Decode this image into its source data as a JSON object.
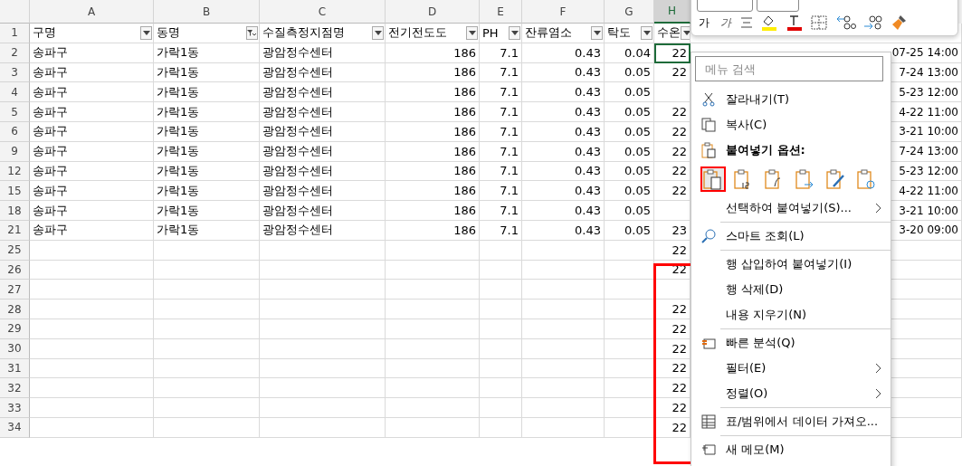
{
  "header_row_num": "1",
  "columns": [
    {
      "letter": "A",
      "header": "구명",
      "filtered": false,
      "selected": false
    },
    {
      "letter": "B",
      "header": "동명",
      "filtered": true,
      "selected": false
    },
    {
      "letter": "C",
      "header": "수질측정지점명",
      "filtered": false,
      "selected": false
    },
    {
      "letter": "D",
      "header": "전기전도도",
      "filtered": false,
      "selected": false
    },
    {
      "letter": "E",
      "header": "PH",
      "filtered": false,
      "selected": false
    },
    {
      "letter": "F",
      "header": "잔류염소",
      "filtered": false,
      "selected": false
    },
    {
      "letter": "G",
      "header": "탁도",
      "filtered": false,
      "selected": false
    },
    {
      "letter": "H",
      "header": "수온",
      "filtered": false,
      "selected": true
    }
  ],
  "rows": [
    {
      "num": "2",
      "cells": [
        "송파구",
        "가락1동",
        "광암정수센터",
        "186",
        "7.1",
        "0.43",
        "0.04",
        "22"
      ],
      "right": "07-25 14:00",
      "selected": true
    },
    {
      "num": "3",
      "cells": [
        "송파구",
        "가락1동",
        "광암정수센터",
        "186",
        "7.1",
        "0.43",
        "0.05",
        "22"
      ],
      "right": "7-24 13:00",
      "selected": false
    },
    {
      "num": "4",
      "cells": [
        "송파구",
        "가락1동",
        "광암정수센터",
        "186",
        "7.1",
        "0.43",
        "0.05",
        ""
      ],
      "right": "5-23 12:00",
      "selected": false
    },
    {
      "num": "5",
      "cells": [
        "송파구",
        "가락1동",
        "광암정수센터",
        "186",
        "7.1",
        "0.43",
        "0.05",
        "22"
      ],
      "right": "4-22 11:00",
      "selected": false
    },
    {
      "num": "6",
      "cells": [
        "송파구",
        "가락1동",
        "광암정수센터",
        "186",
        "7.1",
        "0.43",
        "0.05",
        "22"
      ],
      "right": "3-21 10:00",
      "selected": false
    },
    {
      "num": "9",
      "cells": [
        "송파구",
        "가락1동",
        "광암정수센터",
        "186",
        "7.1",
        "0.43",
        "0.05",
        "22"
      ],
      "right": "7-24 13:00",
      "selected": false
    },
    {
      "num": "12",
      "cells": [
        "송파구",
        "가락1동",
        "광암정수센터",
        "186",
        "7.1",
        "0.43",
        "0.05",
        "22"
      ],
      "right": "5-23 12:00",
      "selected": false
    },
    {
      "num": "15",
      "cells": [
        "송파구",
        "가락1동",
        "광암정수센터",
        "186",
        "7.1",
        "0.43",
        "0.05",
        "22"
      ],
      "right": "4-22 11:00",
      "selected": false
    },
    {
      "num": "18",
      "cells": [
        "송파구",
        "가락1동",
        "광암정수센터",
        "186",
        "7.1",
        "0.43",
        "0.05",
        ""
      ],
      "right": "3-21 10:00",
      "selected": false
    },
    {
      "num": "21",
      "cells": [
        "송파구",
        "가락1동",
        "광암정수센터",
        "186",
        "7.1",
        "0.43",
        "0.05",
        "23"
      ],
      "right": "3-20 09:00",
      "selected": false
    },
    {
      "num": "25",
      "cells": [
        "",
        "",
        "",
        "",
        "",
        "",
        "",
        "22"
      ],
      "right": "",
      "selected": false
    },
    {
      "num": "26",
      "cells": [
        "",
        "",
        "",
        "",
        "",
        "",
        "",
        "22"
      ],
      "right": "",
      "selected": false
    },
    {
      "num": "27",
      "cells": [
        "",
        "",
        "",
        "",
        "",
        "",
        "",
        ""
      ],
      "right": "",
      "selected": false
    },
    {
      "num": "28",
      "cells": [
        "",
        "",
        "",
        "",
        "",
        "",
        "",
        "22"
      ],
      "right": "",
      "selected": false
    },
    {
      "num": "29",
      "cells": [
        "",
        "",
        "",
        "",
        "",
        "",
        "",
        "22"
      ],
      "right": "",
      "selected": false
    },
    {
      "num": "30",
      "cells": [
        "",
        "",
        "",
        "",
        "",
        "",
        "",
        "22"
      ],
      "right": "",
      "selected": false
    },
    {
      "num": "31",
      "cells": [
        "",
        "",
        "",
        "",
        "",
        "",
        "",
        "22"
      ],
      "right": "",
      "selected": false
    },
    {
      "num": "32",
      "cells": [
        "",
        "",
        "",
        "",
        "",
        "",
        "",
        "22"
      ],
      "right": "",
      "selected": false
    },
    {
      "num": "33",
      "cells": [
        "",
        "",
        "",
        "",
        "",
        "",
        "",
        "22"
      ],
      "right": "",
      "selected": false
    },
    {
      "num": "34",
      "cells": [
        "",
        "",
        "",
        "",
        "",
        "",
        "",
        "22"
      ],
      "right": "",
      "selected": false
    }
  ],
  "mini_toolbar": {
    "bold": "가",
    "italic": "가"
  },
  "menu": {
    "search": {
      "placeholder": "메뉴 검색"
    },
    "items": [
      {
        "kind": "item",
        "label": "잘라내기(T)",
        "submenu": false
      },
      {
        "kind": "item",
        "label": "복사(C)",
        "submenu": false
      },
      {
        "kind": "heading",
        "label": "붙여넣기 옵션:",
        "submenu": false
      },
      {
        "kind": "paste_options",
        "options": [
          {
            "selected": true
          },
          {
            "selected": false
          },
          {
            "selected": false
          },
          {
            "selected": false
          },
          {
            "selected": false
          },
          {
            "selected": false
          }
        ]
      },
      {
        "kind": "item",
        "label": "선택하여 붙여넣기(S)...",
        "submenu": true
      },
      {
        "kind": "separator"
      },
      {
        "kind": "item",
        "label": "스마트 조회(L)",
        "submenu": false
      },
      {
        "kind": "separator"
      },
      {
        "kind": "item",
        "label": "행 삽입하여 붙여넣기(I)",
        "submenu": false
      },
      {
        "kind": "item",
        "label": "행 삭제(D)",
        "submenu": false
      },
      {
        "kind": "item",
        "label": "내용 지우기(N)",
        "submenu": false
      },
      {
        "kind": "separator"
      },
      {
        "kind": "item",
        "label": "빠른 분석(Q)",
        "submenu": false
      },
      {
        "kind": "item",
        "label": "필터(E)",
        "submenu": true
      },
      {
        "kind": "item",
        "label": "정렬(O)",
        "submenu": true
      },
      {
        "kind": "separator"
      },
      {
        "kind": "item",
        "label": "표/범위에서 데이터 가져오...",
        "submenu": false
      },
      {
        "kind": "separator"
      },
      {
        "kind": "item",
        "label": "새 메모(M)",
        "submenu": false
      }
    ]
  }
}
